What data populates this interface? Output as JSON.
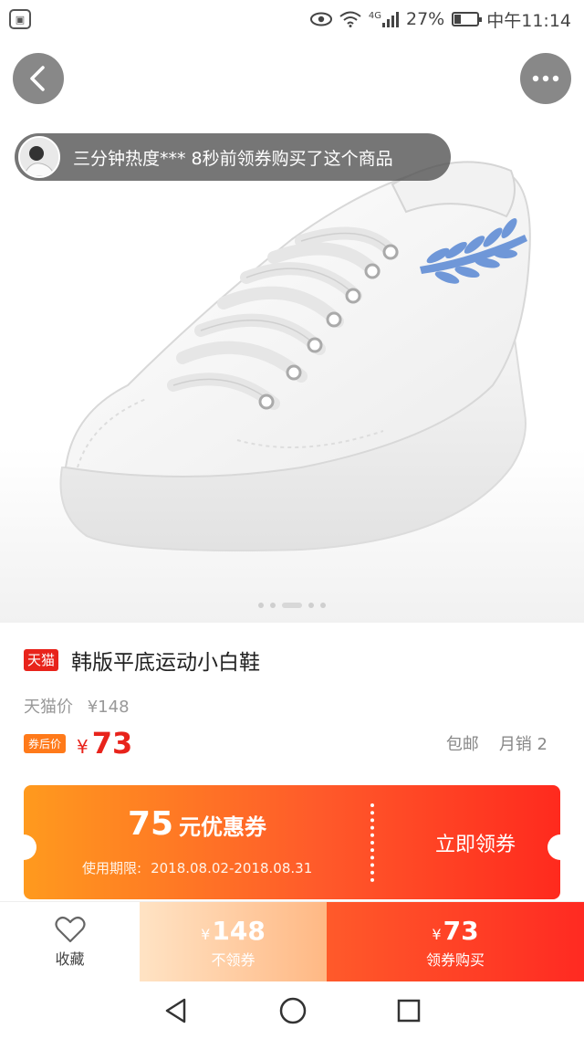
{
  "status_bar": {
    "network": "4G",
    "battery": "27%",
    "battery_level": 0.27,
    "time": "中午11:14"
  },
  "hero": {
    "ticker_text": "三分钟热度*** 8秒前领券购买了这个商品",
    "slide_count": 5,
    "active_slide": 3,
    "icons": {
      "back": "back-arrow-icon",
      "more": "more-dots-icon"
    }
  },
  "product": {
    "platform_tag": "天猫",
    "title": "韩版平底运动小白鞋",
    "orig_price_label": "天猫价",
    "orig_price": "¥148",
    "after_coupon_tag": "券后价",
    "price_currency": "¥",
    "price": "73",
    "shipping": "包邮",
    "monthly_sales": "月销 2"
  },
  "coupon": {
    "amount": "75",
    "unit": "元优惠券",
    "validity_label": "使用期限:",
    "validity_range": "2018.08.02-2018.08.31",
    "claim_label": "立即领券"
  },
  "action_bar": {
    "favorite_label": "收藏",
    "no_coupon_currency": "¥",
    "no_coupon_price": "148",
    "no_coupon_label": "不领券",
    "coupon_currency": "¥",
    "coupon_price": "73",
    "coupon_label": "领券购买"
  },
  "colors": {
    "accent_red": "#e8231b",
    "coupon_orange": "#ff9a1e",
    "coupon_red": "#ff2a1e"
  }
}
